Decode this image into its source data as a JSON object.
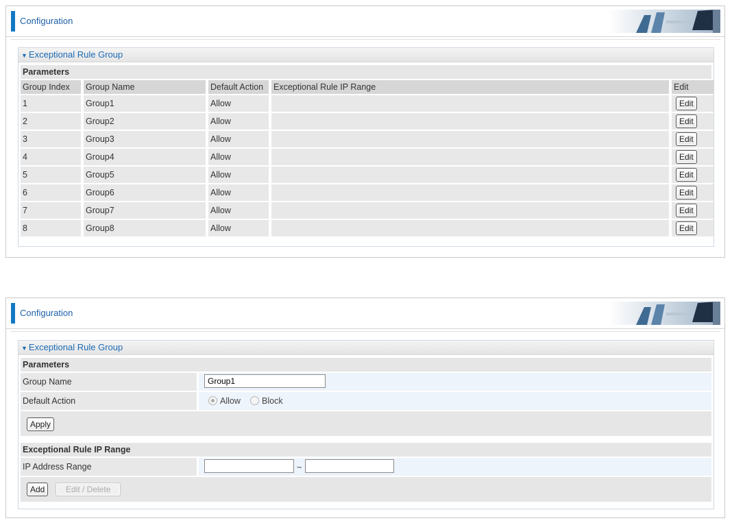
{
  "panel1": {
    "title": "Configuration",
    "section_title": "Exceptional Rule Group",
    "parameters_label": "Parameters",
    "columns": [
      "Group Index",
      "Group Name",
      "Default Action",
      "Exceptional Rule IP Range",
      "Edit"
    ],
    "rows": [
      {
        "index": "1",
        "name": "Group1",
        "action": "Allow",
        "range": "",
        "edit": "Edit"
      },
      {
        "index": "2",
        "name": "Group2",
        "action": "Allow",
        "range": "",
        "edit": "Edit"
      },
      {
        "index": "3",
        "name": "Group3",
        "action": "Allow",
        "range": "",
        "edit": "Edit"
      },
      {
        "index": "4",
        "name": "Group4",
        "action": "Allow",
        "range": "",
        "edit": "Edit"
      },
      {
        "index": "5",
        "name": "Group5",
        "action": "Allow",
        "range": "",
        "edit": "Edit"
      },
      {
        "index": "6",
        "name": "Group6",
        "action": "Allow",
        "range": "",
        "edit": "Edit"
      },
      {
        "index": "7",
        "name": "Group7",
        "action": "Allow",
        "range": "",
        "edit": "Edit"
      },
      {
        "index": "8",
        "name": "Group8",
        "action": "Allow",
        "range": "",
        "edit": "Edit"
      }
    ]
  },
  "panel2": {
    "title": "Configuration",
    "section_title": "Exceptional Rule Group",
    "parameters_label": "Parameters",
    "group_name_label": "Group Name",
    "group_name_value": "Group1",
    "default_action_label": "Default Action",
    "allow_label": "Allow",
    "block_label": "Block",
    "default_action_selected": "Allow",
    "apply_label": "Apply",
    "ip_range_header": "Exceptional Rule IP Range",
    "ip_range_label": "IP Address Range",
    "ip_start_value": "",
    "ip_end_value": "",
    "range_separator": "~",
    "add_label": "Add",
    "edit_delete_label": "Edit / Delete"
  },
  "colors": {
    "accent": "#1379c4",
    "title_text": "#1d5fa8",
    "row_bg": "#e8e8e8",
    "field_bg": "#eef4fb"
  }
}
